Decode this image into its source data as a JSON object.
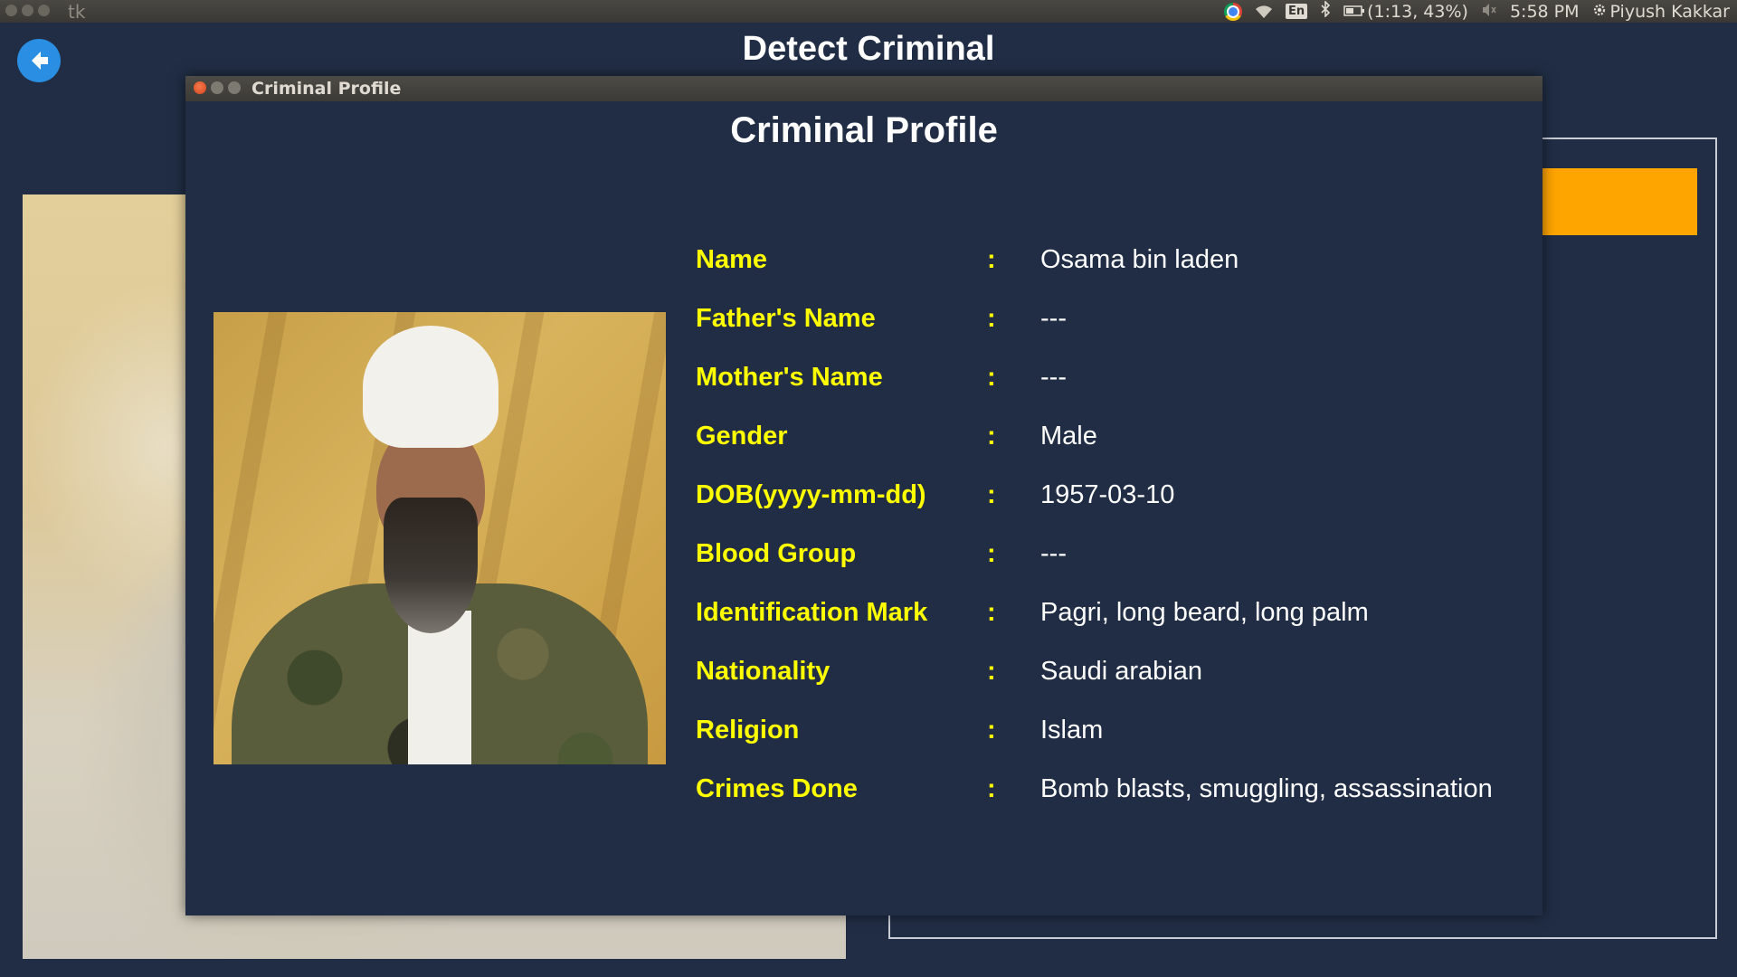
{
  "system_bar": {
    "app_name": "tk",
    "battery": "(1:13, 43%)",
    "time": "5:58 PM",
    "user": "Piyush Kakkar",
    "keyboard": "En"
  },
  "main_window": {
    "title": "Detect Criminal"
  },
  "dialog": {
    "window_title": "Criminal Profile",
    "heading": "Criminal Profile",
    "fields": [
      {
        "label": "Name",
        "sep": ":",
        "value": "Osama bin laden"
      },
      {
        "label": "Father's Name",
        "sep": ":",
        "value": "---"
      },
      {
        "label": "Mother's Name",
        "sep": ":",
        "value": "---"
      },
      {
        "label": "Gender",
        "sep": ":",
        "value": "Male"
      },
      {
        "label": "DOB(yyyy-mm-dd)",
        "sep": ":",
        "value": "1957-03-10"
      },
      {
        "label": "Blood Group",
        "sep": ":",
        "value": "---"
      },
      {
        "label": "Identification Mark",
        "sep": ":",
        "value": "Pagri, long beard, long palm"
      },
      {
        "label": "Nationality",
        "sep": ":",
        "value": "Saudi arabian"
      },
      {
        "label": "Religion",
        "sep": ":",
        "value": "Islam"
      },
      {
        "label": "Crimes Done",
        "sep": ":",
        "value": "Bomb blasts, smuggling, assassination"
      }
    ]
  },
  "colors": {
    "background": "#202d44",
    "label": "#ffff00",
    "value": "#ffffff",
    "accent_orange": "#ffa500",
    "back_button": "#2a8fe3"
  }
}
